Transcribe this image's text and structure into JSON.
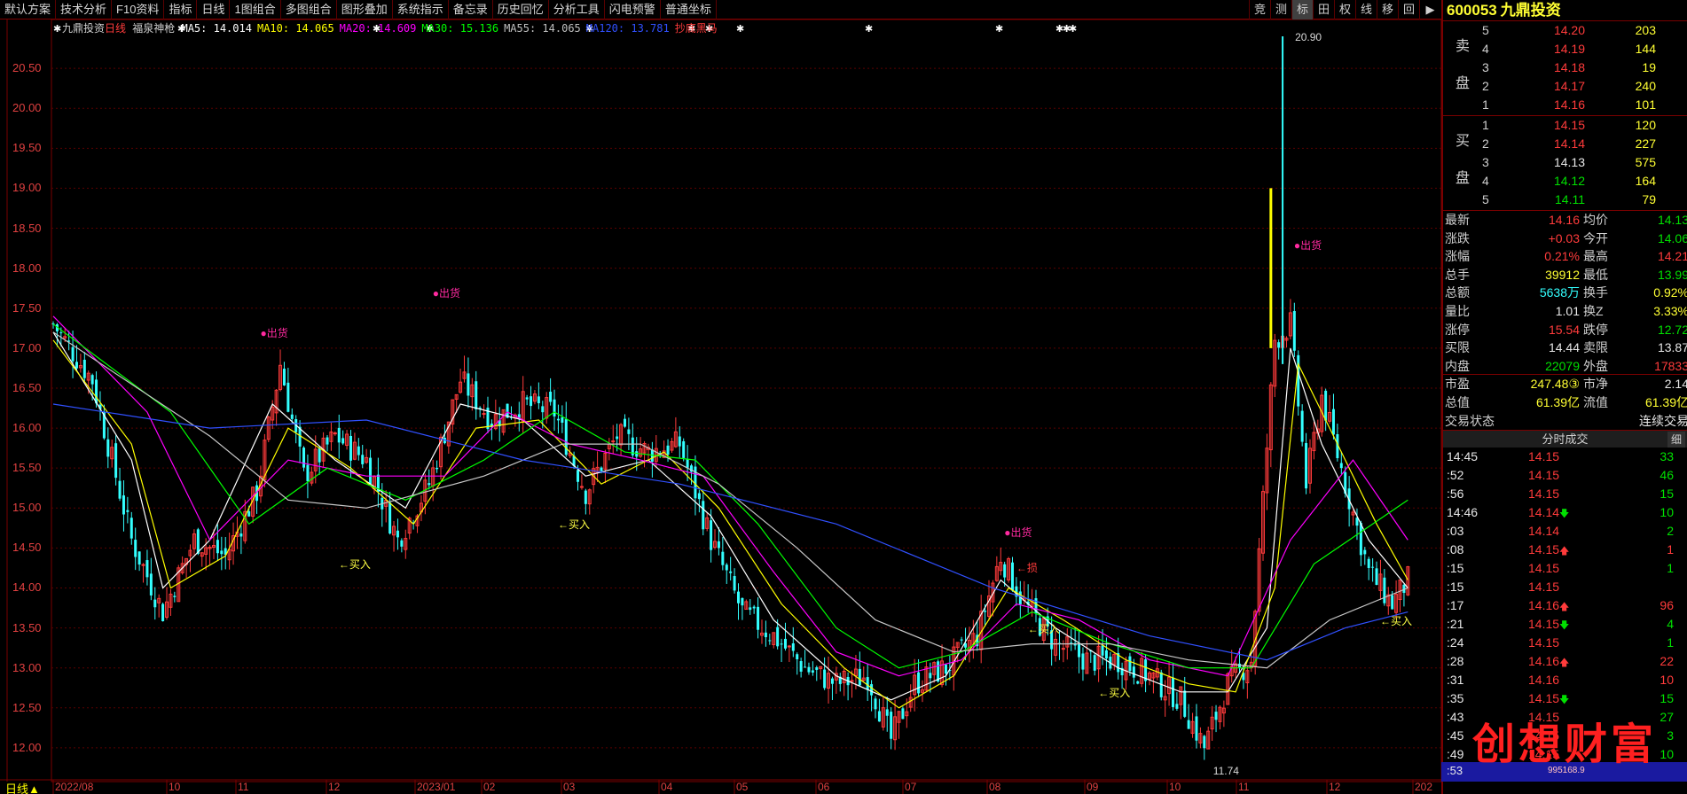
{
  "toolbar": {
    "items": [
      "默认方案",
      "技术分析",
      "F10资料",
      "指标",
      "日线",
      "1图组合",
      "多图组合",
      "图形叠加",
      "系统指示",
      "备忘录",
      "历史回忆",
      "分析工具",
      "闪电预警",
      "普通坐标"
    ],
    "right_buttons": [
      "竞",
      "测",
      "标",
      "田",
      "权",
      "线",
      "移",
      "回",
      "▶"
    ]
  },
  "chart": {
    "stock_name": "九鼎投资",
    "period": "日线",
    "indicator": "福泉神枪",
    "ma_legend": [
      {
        "label": "MA5: 14.014",
        "color": "#ffffff"
      },
      {
        "label": "MA10: 14.065",
        "color": "#ffff00"
      },
      {
        "label": "MA20: 14.609",
        "color": "#ff00ff"
      },
      {
        "label": "MA30: 15.136",
        "color": "#00ff00"
      },
      {
        "label": "MA55: 14.065",
        "color": "#c0c0c0"
      },
      {
        "label": "MA120: 13.781",
        "color": "#3050ff"
      }
    ],
    "extra_label": "抄底黑马",
    "period_label": "日线▲",
    "max_label": "20.90",
    "min_label": "11.74",
    "sell_label": "出货",
    "buy_label": "买入",
    "sell_annotations": [
      {
        "text": "出货"
      },
      {
        "text": "出货"
      },
      {
        "text": "出货"
      },
      {
        "text": "出货"
      }
    ],
    "buy_annotations": [
      {
        "text": "←买入"
      },
      {
        "text": "←买入"
      },
      {
        "text": "←买入"
      },
      {
        "text": "←买入"
      },
      {
        "text": "←买入"
      }
    ],
    "other_annotation": "←损"
  },
  "chart_data": {
    "type": "candlestick",
    "title": "九鼎投资 日线",
    "y_ticks": [
      12.0,
      12.5,
      13.0,
      13.5,
      14.0,
      14.5,
      15.0,
      15.5,
      16.0,
      16.5,
      17.0,
      17.5,
      18.0,
      18.5,
      19.0,
      19.5,
      20.0,
      20.5
    ],
    "y_tick_labels": [
      "12.00",
      "12.50",
      "13.00",
      "13.50",
      "14.00",
      "14.50",
      "15.00",
      "15.50",
      "16.00",
      "16.50",
      "17.00",
      "17.50",
      "18.00",
      "18.50",
      "19.00",
      "19.50",
      "20.00",
      "20.50"
    ],
    "ylim": [
      11.6,
      21.0
    ],
    "x_ticks": [
      "2022/08",
      "10",
      "11",
      "12",
      "2023/01",
      "02",
      "03",
      "04",
      "05",
      "06",
      "07",
      "08",
      "09",
      "10",
      "11",
      "12",
      "202"
    ],
    "close_path": [
      [
        0,
        17.3
      ],
      [
        10,
        16.6
      ],
      [
        20,
        14.6
      ],
      [
        28,
        13.7
      ],
      [
        36,
        14.6
      ],
      [
        44,
        14.4
      ],
      [
        52,
        15.2
      ],
      [
        58,
        16.8
      ],
      [
        64,
        15.4
      ],
      [
        72,
        15.9
      ],
      [
        80,
        15.6
      ],
      [
        88,
        14.6
      ],
      [
        96,
        15.3
      ],
      [
        104,
        16.6
      ],
      [
        112,
        16.1
      ],
      [
        120,
        16.3
      ],
      [
        128,
        16.2
      ],
      [
        136,
        15.2
      ],
      [
        144,
        15.9
      ],
      [
        152,
        15.7
      ],
      [
        160,
        15.8
      ],
      [
        168,
        14.6
      ],
      [
        176,
        13.7
      ],
      [
        184,
        13.4
      ],
      [
        192,
        13.0
      ],
      [
        200,
        12.8
      ],
      [
        208,
        12.9
      ],
      [
        214,
        12.1
      ],
      [
        220,
        12.8
      ],
      [
        228,
        13.0
      ],
      [
        236,
        13.4
      ],
      [
        242,
        14.4
      ],
      [
        248,
        13.8
      ],
      [
        256,
        13.3
      ],
      [
        264,
        13.1
      ],
      [
        272,
        13.1
      ],
      [
        280,
        12.9
      ],
      [
        288,
        12.6
      ],
      [
        294,
        12.0
      ],
      [
        300,
        12.8
      ],
      [
        306,
        13.1
      ],
      [
        312,
        17.1
      ],
      [
        316,
        17.3
      ],
      [
        320,
        15.3
      ],
      [
        324,
        16.4
      ],
      [
        330,
        15.3
      ],
      [
        336,
        14.2
      ],
      [
        342,
        13.8
      ],
      [
        346,
        14.1
      ]
    ],
    "ma_series": [
      {
        "name": "MA5",
        "color": "#ffffff",
        "values": [
          [
            0,
            17.2
          ],
          [
            20,
            15.6
          ],
          [
            28,
            14.0
          ],
          [
            40,
            14.6
          ],
          [
            56,
            16.3
          ],
          [
            72,
            15.6
          ],
          [
            90,
            15.0
          ],
          [
            104,
            16.3
          ],
          [
            120,
            16.1
          ],
          [
            136,
            15.4
          ],
          [
            152,
            15.6
          ],
          [
            168,
            14.9
          ],
          [
            184,
            13.6
          ],
          [
            200,
            12.9
          ],
          [
            214,
            12.6
          ],
          [
            228,
            12.9
          ],
          [
            242,
            14.1
          ],
          [
            256,
            13.5
          ],
          [
            272,
            13.0
          ],
          [
            288,
            12.7
          ],
          [
            300,
            12.7
          ],
          [
            310,
            13.5
          ],
          [
            316,
            17.0
          ],
          [
            324,
            15.8
          ],
          [
            336,
            14.6
          ],
          [
            346,
            14.0
          ]
        ]
      },
      {
        "name": "MA10",
        "color": "#ffff00",
        "values": [
          [
            0,
            17.1
          ],
          [
            20,
            15.8
          ],
          [
            30,
            14.0
          ],
          [
            44,
            14.4
          ],
          [
            60,
            16.0
          ],
          [
            76,
            15.5
          ],
          [
            92,
            14.8
          ],
          [
            108,
            16.0
          ],
          [
            124,
            16.1
          ],
          [
            140,
            15.3
          ],
          [
            156,
            15.7
          ],
          [
            170,
            15.0
          ],
          [
            186,
            13.8
          ],
          [
            202,
            13.0
          ],
          [
            216,
            12.5
          ],
          [
            230,
            12.9
          ],
          [
            244,
            14.0
          ],
          [
            258,
            13.6
          ],
          [
            274,
            13.1
          ],
          [
            290,
            12.8
          ],
          [
            302,
            12.7
          ],
          [
            312,
            14.0
          ],
          [
            318,
            16.8
          ],
          [
            326,
            16.0
          ],
          [
            338,
            14.8
          ],
          [
            346,
            14.1
          ]
        ]
      },
      {
        "name": "MA20",
        "color": "#ff00ff",
        "values": [
          [
            0,
            17.4
          ],
          [
            24,
            16.2
          ],
          [
            40,
            14.6
          ],
          [
            60,
            15.6
          ],
          [
            80,
            15.4
          ],
          [
            100,
            15.4
          ],
          [
            116,
            16.2
          ],
          [
            132,
            15.8
          ],
          [
            150,
            15.6
          ],
          [
            166,
            15.4
          ],
          [
            184,
            14.2
          ],
          [
            200,
            13.2
          ],
          [
            216,
            12.9
          ],
          [
            232,
            13.1
          ],
          [
            246,
            13.8
          ],
          [
            262,
            13.6
          ],
          [
            280,
            13.1
          ],
          [
            300,
            12.9
          ],
          [
            316,
            14.6
          ],
          [
            332,
            15.6
          ],
          [
            346,
            14.6
          ]
        ]
      },
      {
        "name": "MA30",
        "color": "#00ff00",
        "values": [
          [
            0,
            17.3
          ],
          [
            30,
            16.2
          ],
          [
            50,
            14.8
          ],
          [
            70,
            15.5
          ],
          [
            90,
            15.1
          ],
          [
            110,
            15.6
          ],
          [
            128,
            16.2
          ],
          [
            146,
            15.7
          ],
          [
            164,
            15.6
          ],
          [
            180,
            14.8
          ],
          [
            200,
            13.5
          ],
          [
            216,
            13.0
          ],
          [
            232,
            13.2
          ],
          [
            250,
            13.7
          ],
          [
            270,
            13.3
          ],
          [
            290,
            13.0
          ],
          [
            306,
            13.0
          ],
          [
            322,
            14.3
          ],
          [
            346,
            15.1
          ]
        ]
      },
      {
        "name": "MA55",
        "color": "#c8c8c8",
        "values": [
          [
            0,
            17.2
          ],
          [
            40,
            15.9
          ],
          [
            60,
            15.1
          ],
          [
            80,
            15.0
          ],
          [
            110,
            15.4
          ],
          [
            130,
            15.8
          ],
          [
            150,
            15.8
          ],
          [
            170,
            15.3
          ],
          [
            190,
            14.5
          ],
          [
            210,
            13.6
          ],
          [
            230,
            13.2
          ],
          [
            250,
            13.3
          ],
          [
            270,
            13.3
          ],
          [
            290,
            13.1
          ],
          [
            310,
            13.0
          ],
          [
            326,
            13.6
          ],
          [
            346,
            14.0
          ]
        ]
      },
      {
        "name": "MA120",
        "color": "#3050ff",
        "values": [
          [
            0,
            16.3
          ],
          [
            40,
            16.0
          ],
          [
            80,
            16.1
          ],
          [
            120,
            15.6
          ],
          [
            160,
            15.3
          ],
          [
            200,
            14.8
          ],
          [
            240,
            14.0
          ],
          [
            280,
            13.4
          ],
          [
            310,
            13.1
          ],
          [
            330,
            13.5
          ],
          [
            346,
            13.7
          ]
        ]
      }
    ],
    "annotations": [
      {
        "type": "sell",
        "x": 52,
        "y": 17.2
      },
      {
        "type": "sell",
        "x": 96,
        "y": 17.7
      },
      {
        "type": "sell",
        "x": 242,
        "y": 14.7
      },
      {
        "type": "sell",
        "x": 316,
        "y": 18.3
      },
      {
        "type": "buy",
        "x": 72,
        "y": 14.3
      },
      {
        "type": "buy",
        "x": 128,
        "y": 14.8
      },
      {
        "type": "buy",
        "x": 248,
        "y": 13.5
      },
      {
        "type": "buy",
        "x": 266,
        "y": 12.7
      },
      {
        "type": "buy",
        "x": 338,
        "y": 13.6
      }
    ]
  },
  "panel": {
    "code": "600053",
    "name": "九鼎投资",
    "sell_side_label": [
      "卖",
      "盘"
    ],
    "buy_side_label": [
      "买",
      "盘"
    ],
    "asks": [
      {
        "level": "5",
        "price": "14.20",
        "vol": "203"
      },
      {
        "level": "4",
        "price": "14.19",
        "vol": "144"
      },
      {
        "level": "3",
        "price": "14.18",
        "vol": "19"
      },
      {
        "level": "2",
        "price": "14.17",
        "vol": "240"
      },
      {
        "level": "1",
        "price": "14.16",
        "vol": "101"
      }
    ],
    "bids": [
      {
        "level": "1",
        "price": "14.15",
        "vol": "120"
      },
      {
        "level": "2",
        "price": "14.14",
        "vol": "227"
      },
      {
        "level": "3",
        "price": "14.13",
        "vol": "575"
      },
      {
        "level": "4",
        "price": "14.12",
        "vol": "164"
      },
      {
        "level": "5",
        "price": "14.11",
        "vol": "79"
      }
    ],
    "quotes": [
      {
        "k": "最新",
        "v": "14.16",
        "vc": "red",
        "k2": "均价",
        "v2": "14.13",
        "v2c": "green"
      },
      {
        "k": "涨跌",
        "v": "+0.03",
        "vc": "red",
        "k2": "今开",
        "v2": "14.06",
        "v2c": "green"
      },
      {
        "k": "涨幅",
        "v": "0.21%",
        "vc": "red",
        "k2": "最高",
        "v2": "14.21",
        "v2c": "red"
      },
      {
        "k": "总手",
        "v": "39912",
        "vc": "yellow",
        "k2": "最低",
        "v2": "13.99",
        "v2c": "green"
      },
      {
        "k": "总额",
        "v": "5638万",
        "vc": "cyan",
        "k2": "换手",
        "v2": "0.92%",
        "v2c": "yellow"
      },
      {
        "k": "量比",
        "v": "1.01",
        "vc": "white",
        "k2": "换Z",
        "v2": "3.33%",
        "v2c": "yellow"
      },
      {
        "k": "涨停",
        "v": "15.54",
        "vc": "red",
        "k2": "跌停",
        "v2": "12.72",
        "v2c": "green"
      },
      {
        "k": "买限",
        "v": "14.44",
        "vc": "white",
        "k2": "卖限",
        "v2": "13.87",
        "v2c": "white"
      },
      {
        "k": "内盘",
        "v": "22079",
        "vc": "green",
        "k2": "外盘",
        "v2": "17833",
        "v2c": "red"
      },
      {
        "k": "市盈",
        "v": "247.48③",
        "vc": "yellow",
        "k2": "市净",
        "v2": "2.14",
        "v2c": "white"
      },
      {
        "k": "总值",
        "v": "61.39亿",
        "vc": "yellow",
        "k2": "流值",
        "v2": "61.39亿",
        "v2c": "yellow"
      },
      {
        "k": "交易状态",
        "v": "",
        "vc": "white",
        "k2": "",
        "v2": "连续交易",
        "v2c": "white"
      }
    ],
    "ticks_title": "分时成交",
    "ticks_detail": "细",
    "ticks": [
      {
        "t": "14:45",
        "p": "14.15",
        "a": "",
        "q": "33",
        "qc": "green"
      },
      {
        "t": ":52",
        "p": "14.15",
        "a": "",
        "q": "46",
        "qc": "green"
      },
      {
        "t": ":56",
        "p": "14.15",
        "a": "",
        "q": "15",
        "qc": "green"
      },
      {
        "t": "14:46",
        "p": "14.14",
        "a": "dn",
        "q": "10",
        "qc": "green"
      },
      {
        "t": ":03",
        "p": "14.14",
        "a": "",
        "q": "2",
        "qc": "green"
      },
      {
        "t": ":08",
        "p": "14.15",
        "a": "up",
        "q": "1",
        "qc": "red"
      },
      {
        "t": ":15",
        "p": "14.15",
        "a": "",
        "q": "1",
        "qc": "green"
      },
      {
        "t": ":15",
        "p": "14.15",
        "a": "",
        "q": "",
        "qc": "green"
      },
      {
        "t": ":17",
        "p": "14.16",
        "a": "up",
        "q": "96",
        "qc": "red"
      },
      {
        "t": ":21",
        "p": "14.15",
        "a": "dn",
        "q": "4",
        "qc": "green"
      },
      {
        "t": ":24",
        "p": "14.15",
        "a": "",
        "q": "1",
        "qc": "green"
      },
      {
        "t": ":28",
        "p": "14.16",
        "a": "up",
        "q": "22",
        "qc": "red"
      },
      {
        "t": ":31",
        "p": "14.16",
        "a": "",
        "q": "10",
        "qc": "red"
      },
      {
        "t": ":35",
        "p": "14.15",
        "a": "dn",
        "q": "15",
        "qc": "green"
      },
      {
        "t": ":43",
        "p": "14.15",
        "a": "",
        "q": "27",
        "qc": "green"
      },
      {
        "t": ":45",
        "p": "14.15",
        "a": "",
        "q": "3",
        "qc": "green"
      },
      {
        "t": ":49",
        "p": "14.15",
        "a": "",
        "q": "10",
        "qc": "green"
      }
    ],
    "last_tick_time": ":53",
    "last_tick_num": "995168.9",
    "watermark": "创想财富"
  }
}
